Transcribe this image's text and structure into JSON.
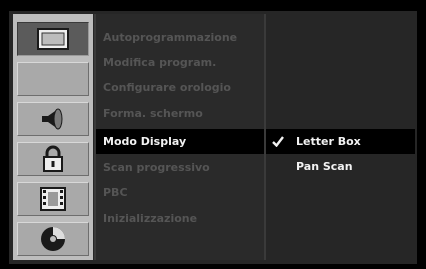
{
  "icons": [
    {
      "name": "display-icon",
      "active": true
    },
    {
      "name": "language-icon",
      "active": false
    },
    {
      "name": "audio-icon",
      "active": false
    },
    {
      "name": "lock-icon",
      "active": false
    },
    {
      "name": "record-icon",
      "active": false
    },
    {
      "name": "disc-icon",
      "active": false
    }
  ],
  "settings": {
    "items": [
      {
        "label": "Autoprogrammazione"
      },
      {
        "label": "Modifica program."
      },
      {
        "label": "Configurare orologio"
      },
      {
        "label": "Forma. schermo"
      },
      {
        "label": "Modo Display"
      },
      {
        "label": "Scan progressivo"
      },
      {
        "label": "PBC"
      },
      {
        "label": "Inizializzazione"
      }
    ],
    "selected_index": 4
  },
  "options": {
    "items": [
      {
        "label": "Letter Box",
        "checked": true
      },
      {
        "label": "Pan Scan",
        "checked": false
      }
    ]
  },
  "colors": {
    "icon_column": "#bdbdbd",
    "active_icon": "#5b5b5b",
    "disabled_text": "#555555",
    "selected_text": "#f2f2f2",
    "highlight": "#000000"
  }
}
